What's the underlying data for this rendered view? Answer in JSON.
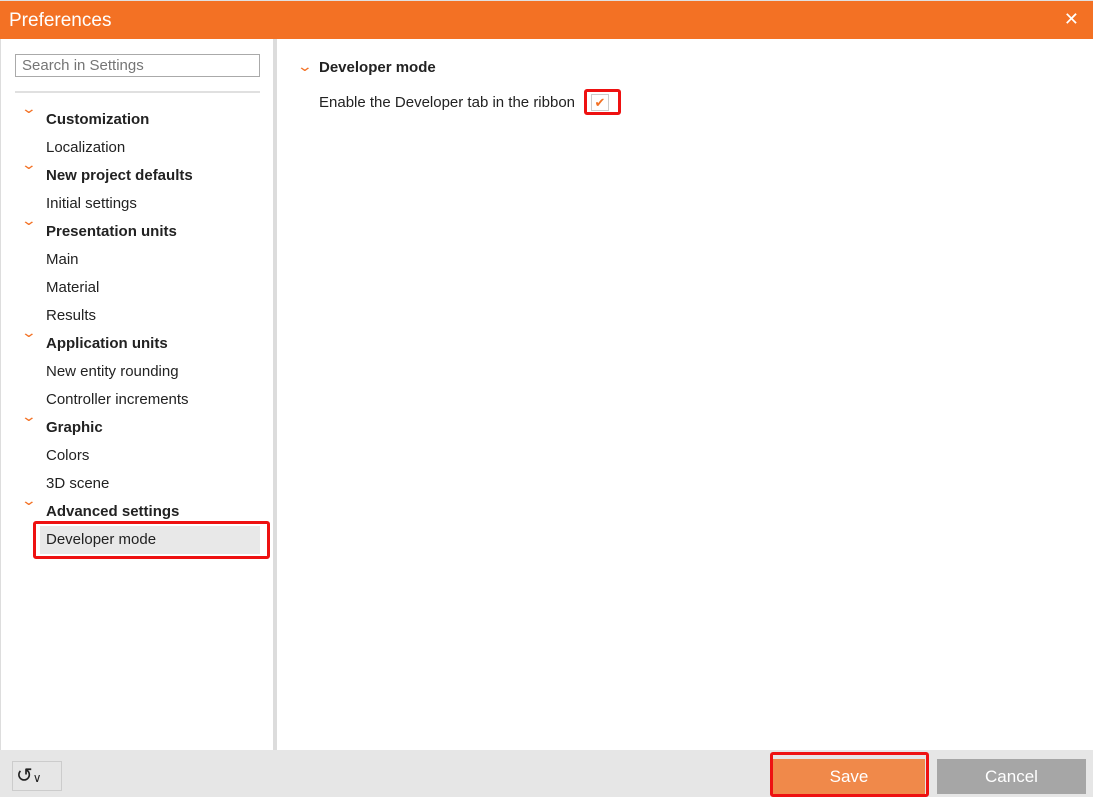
{
  "window": {
    "title": "Preferences"
  },
  "search": {
    "placeholder": "Search in Settings"
  },
  "tree": [
    {
      "label": "Customization",
      "head": true
    },
    {
      "label": "Localization"
    },
    {
      "label": "New project defaults",
      "head": true
    },
    {
      "label": "Initial settings"
    },
    {
      "label": "Presentation units",
      "head": true
    },
    {
      "label": "Main"
    },
    {
      "label": "Material"
    },
    {
      "label": "Results"
    },
    {
      "label": "Application units",
      "head": true
    },
    {
      "label": "New entity rounding"
    },
    {
      "label": "Controller increments"
    },
    {
      "label": "Graphic",
      "head": true
    },
    {
      "label": "Colors"
    },
    {
      "label": "3D scene"
    },
    {
      "label": "Advanced settings",
      "head": true
    },
    {
      "label": "Developer mode",
      "selected": true
    }
  ],
  "content": {
    "section_title": "Developer mode",
    "option_label": "Enable the Developer tab in the ribbon",
    "option_checked": true
  },
  "footer": {
    "save": "Save",
    "cancel": "Cancel"
  },
  "colors": {
    "accent": "#f37124",
    "save": "#f0894a",
    "cancel": "#a6a6a6"
  }
}
